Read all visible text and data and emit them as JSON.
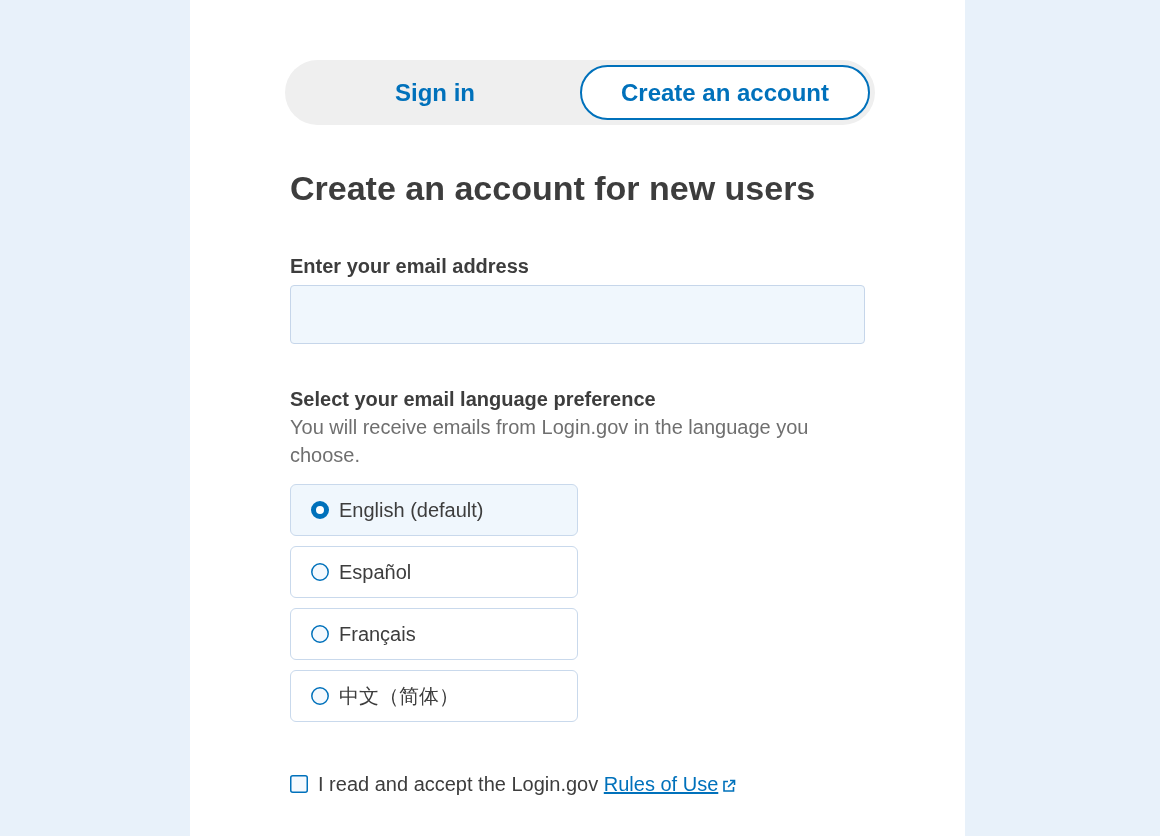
{
  "tabs": [
    {
      "label": "Sign in",
      "selected": false
    },
    {
      "label": "Create an account",
      "selected": true
    }
  ],
  "heading": "Create an account for new users",
  "email_field": {
    "label": "Enter your email address"
  },
  "language": {
    "label": "Select your email language preference",
    "hint": "You will receive emails from Login.gov in the language you choose.",
    "options": [
      {
        "label": "English (default)",
        "selected": true
      },
      {
        "label": "Español",
        "selected": false
      },
      {
        "label": "Français",
        "selected": false
      },
      {
        "label": "中文（简体）",
        "selected": false
      }
    ]
  },
  "terms": {
    "text": "I read and accept the Login.gov",
    "link": "Rules of Use",
    "checked": false
  }
}
